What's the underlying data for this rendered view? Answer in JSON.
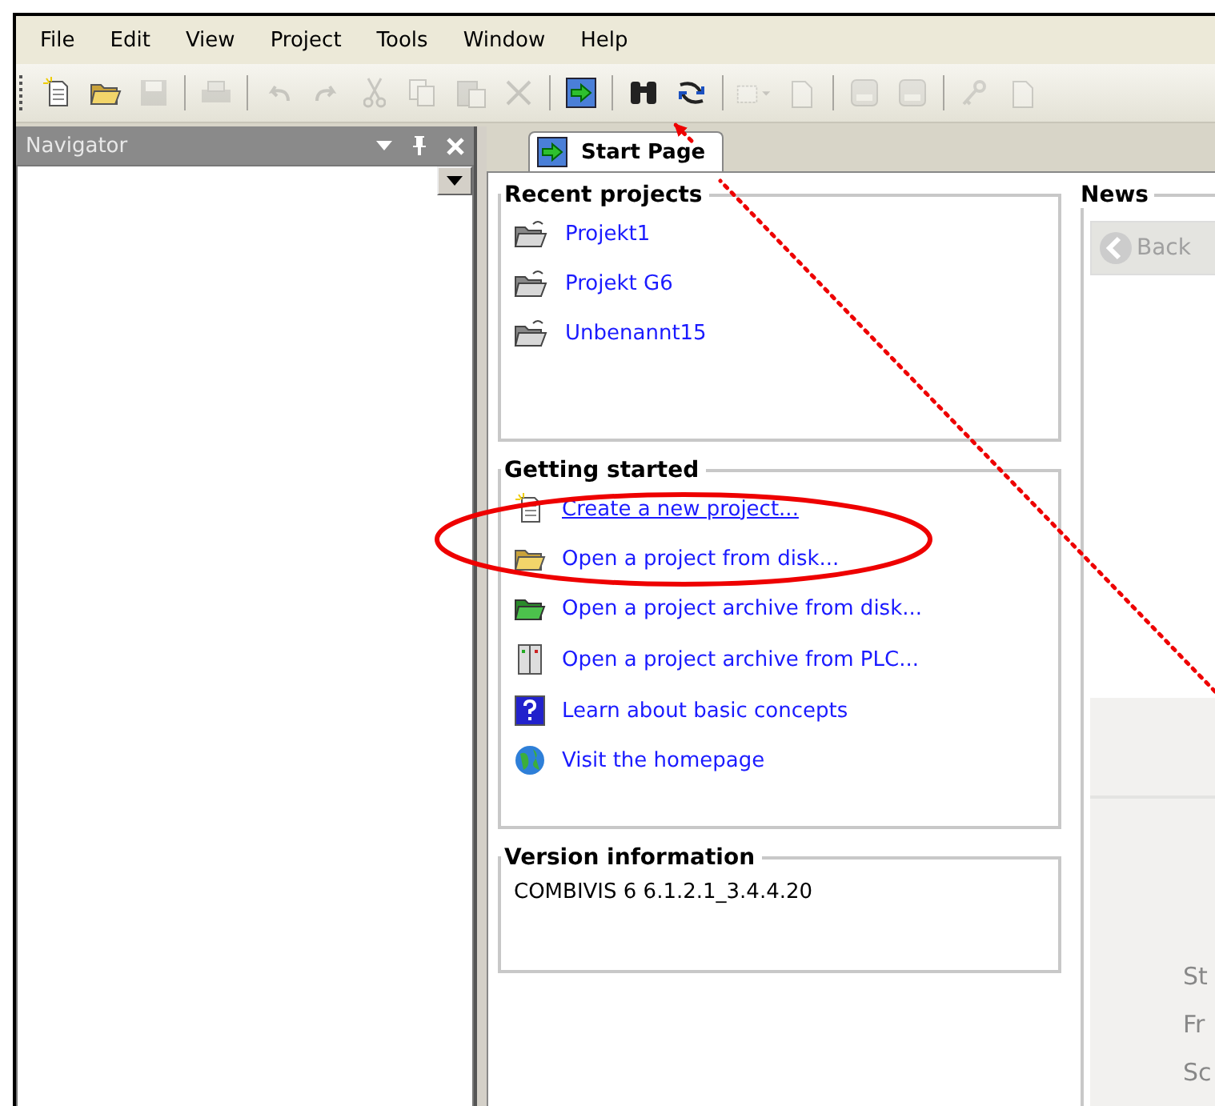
{
  "menu": [
    "File",
    "Edit",
    "View",
    "Project",
    "Tools",
    "Window",
    "Help"
  ],
  "toolbar": [
    {
      "kind": "new",
      "disabled": false
    },
    {
      "kind": "open",
      "disabled": false
    },
    {
      "kind": "save",
      "disabled": true
    },
    {
      "kind": "sep"
    },
    {
      "kind": "print",
      "disabled": true
    },
    {
      "kind": "sep"
    },
    {
      "kind": "undo",
      "disabled": true
    },
    {
      "kind": "redo",
      "disabled": true
    },
    {
      "kind": "cut",
      "disabled": true
    },
    {
      "kind": "copy",
      "disabled": true
    },
    {
      "kind": "paste",
      "disabled": true
    },
    {
      "kind": "delete",
      "disabled": true
    },
    {
      "kind": "sep"
    },
    {
      "kind": "start",
      "disabled": false
    },
    {
      "kind": "sep"
    },
    {
      "kind": "find",
      "disabled": false
    },
    {
      "kind": "replace",
      "disabled": false
    },
    {
      "kind": "sep"
    },
    {
      "kind": "grid",
      "disabled": true
    },
    {
      "kind": "page",
      "disabled": true
    },
    {
      "kind": "sep"
    },
    {
      "kind": "device",
      "disabled": true
    },
    {
      "kind": "device",
      "disabled": true
    },
    {
      "kind": "sep"
    },
    {
      "kind": "key",
      "disabled": true
    },
    {
      "kind": "page",
      "disabled": true
    }
  ],
  "navigator": {
    "title": "Navigator"
  },
  "tabs": [
    {
      "label": "Start Page",
      "selected": true
    }
  ],
  "recent_projects": {
    "title": "Recent projects",
    "items": [
      "Projekt1",
      "Projekt G6",
      "Unbenannt15"
    ]
  },
  "getting_started": {
    "title": "Getting started",
    "items": [
      {
        "kind": "new",
        "label": "Create a new project...",
        "underlined": true
      },
      {
        "kind": "open",
        "label": "Open a project from disk...",
        "underlined": false
      },
      {
        "kind": "archive",
        "label": "Open a project archive from disk...",
        "underlined": false
      },
      {
        "kind": "plc",
        "label": "Open a project archive from PLC...",
        "underlined": false
      },
      {
        "kind": "help",
        "label": "Learn about basic concepts",
        "underlined": false
      },
      {
        "kind": "web",
        "label": "Visit the homepage",
        "underlined": false
      }
    ]
  },
  "version": {
    "title": "Version information",
    "text": "COMBIVIS 6 6.1.2.1_3.4.4.20"
  },
  "news": {
    "title": "News",
    "back": {
      "label": "Back",
      "disabled": true
    },
    "labels": [
      "St",
      "Fr",
      "Sc"
    ]
  }
}
